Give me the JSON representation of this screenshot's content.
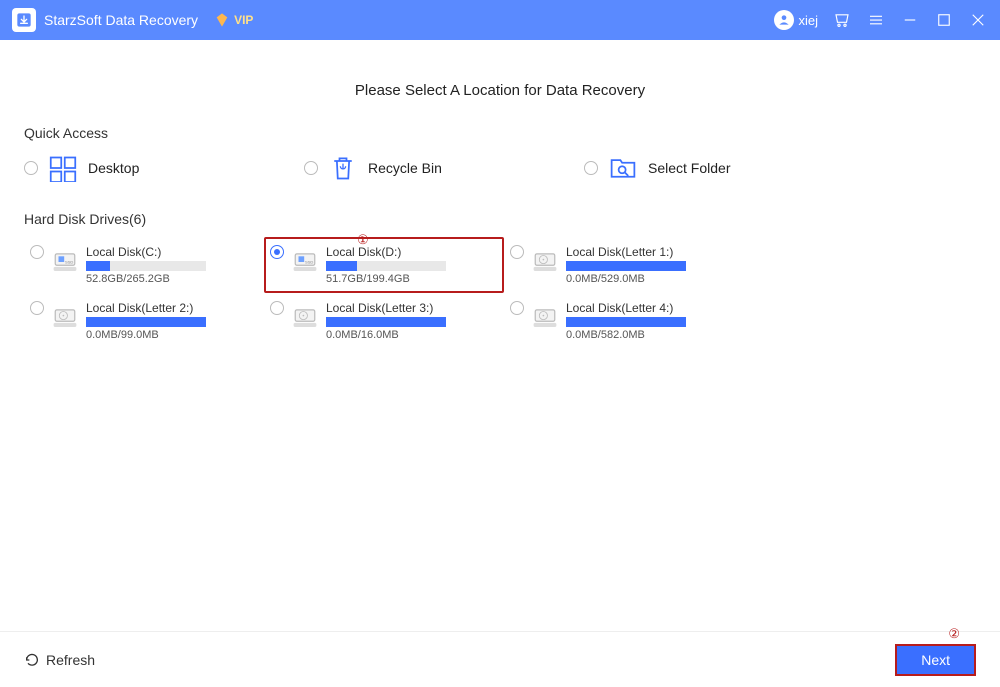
{
  "titlebar": {
    "app_name": "StarzSoft Data Recovery",
    "vip_label": "VIP",
    "username": "xiej"
  },
  "page": {
    "title": "Please Select A Location for Data Recovery"
  },
  "quick_access": {
    "label": "Quick Access",
    "items": [
      {
        "id": "desktop",
        "label": "Desktop"
      },
      {
        "id": "recycle",
        "label": "Recycle Bin"
      },
      {
        "id": "folder",
        "label": "Select Folder"
      }
    ]
  },
  "drives_section": {
    "label": "Hard Disk Drives(6)"
  },
  "drives": [
    {
      "name": "Local Disk(C:)",
      "usage": "52.8GB/265.2GB",
      "fill": 20,
      "selected": false,
      "ssd": true
    },
    {
      "name": "Local Disk(D:)",
      "usage": "51.7GB/199.4GB",
      "fill": 26,
      "selected": true,
      "ssd": true
    },
    {
      "name": "Local Disk(Letter 1:)",
      "usage": "0.0MB/529.0MB",
      "fill": 100,
      "selected": false,
      "ssd": false
    },
    {
      "name": "Local Disk(Letter 2:)",
      "usage": "0.0MB/99.0MB",
      "fill": 100,
      "selected": false,
      "ssd": false
    },
    {
      "name": "Local Disk(Letter 3:)",
      "usage": "0.0MB/16.0MB",
      "fill": 100,
      "selected": false,
      "ssd": false
    },
    {
      "name": "Local Disk(Letter 4:)",
      "usage": "0.0MB/582.0MB",
      "fill": 100,
      "selected": false,
      "ssd": false
    }
  ],
  "annotations": {
    "one": "①",
    "two": "②"
  },
  "footer": {
    "refresh": "Refresh",
    "next": "Next"
  },
  "colors": {
    "primary": "#3a6fff",
    "titlebar": "#5a8aff",
    "highlight_border": "#b71c1c"
  }
}
